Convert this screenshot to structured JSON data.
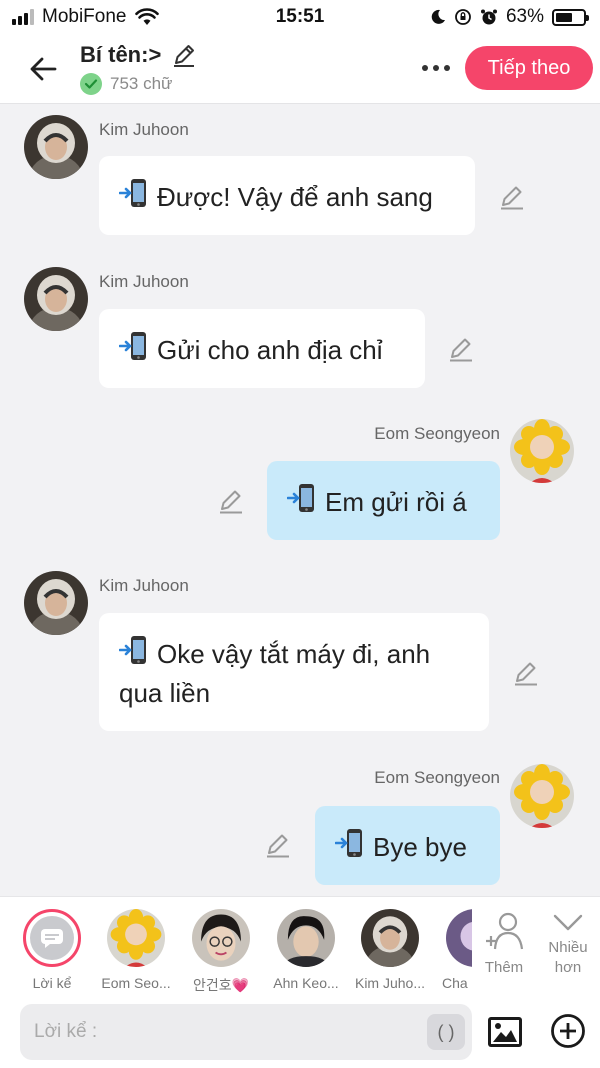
{
  "status_bar": {
    "carrier": "MobiFone",
    "time": "15:51",
    "battery_percent": "63%",
    "battery_level": 0.63
  },
  "header": {
    "title": "Bí tên:>",
    "word_count": "753 chữ",
    "next_label": "Tiếp theo",
    "accent_color": "#f5456a"
  },
  "messages": [
    {
      "sender": "Kim Juhoon",
      "side": "left",
      "lines": [
        "Được! Vậy để anh sang"
      ]
    },
    {
      "sender": "Kim Juhoon",
      "side": "left",
      "lines": [
        "Gửi cho anh địa chỉ"
      ]
    },
    {
      "sender": "Eom Seongyeon",
      "side": "right",
      "lines": [
        "Em gửi rồi á"
      ]
    },
    {
      "sender": "Kim Juhoon",
      "side": "left",
      "lines": [
        "Oke vậy tắt máy đi, anh",
        "qua liền"
      ]
    },
    {
      "sender": "Eom Seongyeon",
      "side": "right",
      "lines": [
        "Bye bye"
      ]
    }
  ],
  "characters": [
    {
      "name": "Lời kể",
      "type": "narrator"
    },
    {
      "name": "Eom Seo...",
      "type": "sunflower"
    },
    {
      "name": "안건호💗",
      "type": "glasses"
    },
    {
      "name": "Ahn Keo...",
      "type": "dark"
    },
    {
      "name": "Kim Juho...",
      "type": "hoodie"
    },
    {
      "name": "Cha",
      "type": "partial"
    }
  ],
  "tools": {
    "add_label": "Thêm",
    "more_label_1": "Nhiều",
    "more_label_2": "hơn"
  },
  "input": {
    "placeholder": "Lời kể :",
    "paren_label": "( )"
  },
  "colors": {
    "left_bubble": "#ffffff",
    "right_bubble": "#c9eafa",
    "background": "#f2f2f4"
  }
}
